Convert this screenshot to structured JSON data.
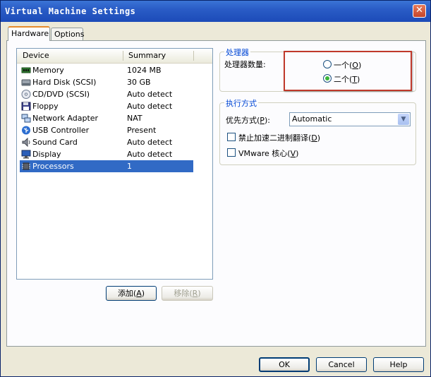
{
  "window": {
    "title": "Virtual Machine Settings",
    "close_glyph": "✕"
  },
  "tabs": [
    {
      "label": "Hardware",
      "active": true
    },
    {
      "label": "Options",
      "active": false
    }
  ],
  "device_list": {
    "headers": {
      "device": "Device",
      "summary": "Summary"
    },
    "rows": [
      {
        "icon": "memory-icon",
        "device": "Memory",
        "summary": "1024 MB",
        "selected": false
      },
      {
        "icon": "hard-disk-icon",
        "device": "Hard Disk (SCSI)",
        "summary": "30 GB",
        "selected": false
      },
      {
        "icon": "cd-dvd-icon",
        "device": "CD/DVD (SCSI)",
        "summary": "Auto detect",
        "selected": false
      },
      {
        "icon": "floppy-icon",
        "device": "Floppy",
        "summary": "Auto detect",
        "selected": false
      },
      {
        "icon": "network-adapter-icon",
        "device": "Network Adapter",
        "summary": "NAT",
        "selected": false
      },
      {
        "icon": "usb-controller-icon",
        "device": "USB Controller",
        "summary": "Present",
        "selected": false
      },
      {
        "icon": "sound-card-icon",
        "device": "Sound Card",
        "summary": "Auto detect",
        "selected": false
      },
      {
        "icon": "display-icon",
        "device": "Display",
        "summary": "Auto detect",
        "selected": false
      },
      {
        "icon": "processor-icon",
        "device": "Processors",
        "summary": "1",
        "selected": true
      }
    ]
  },
  "list_buttons": {
    "add": {
      "text": "添加(",
      "key": "A",
      "suffix": ")"
    },
    "remove": {
      "text": "移除(",
      "key": "R",
      "suffix": ")"
    }
  },
  "processors_group": {
    "title": "处理器",
    "count_label": "处理器数量:",
    "options": [
      {
        "text": "一个(",
        "key": "O",
        "suffix": ")",
        "checked": false
      },
      {
        "text": "二个(",
        "key": "T",
        "suffix": ")",
        "checked": true
      }
    ]
  },
  "execution_group": {
    "title": "执行方式",
    "priority_label": {
      "text": "优先方式(",
      "key": "P",
      "suffix": "):"
    },
    "priority_value": "Automatic",
    "checkboxes": [
      {
        "text": "禁止加速二进制翻译(",
        "key": "D",
        "suffix": ")",
        "checked": false
      },
      {
        "text": "VMware 核心(",
        "key": "V",
        "suffix": ")",
        "checked": false
      }
    ]
  },
  "footer_buttons": {
    "ok": "OK",
    "cancel": "Cancel",
    "help": "Help"
  },
  "colors": {
    "accent_highlight": "#c0392b",
    "selection": "#316ac5",
    "group_title": "#0046d5"
  }
}
